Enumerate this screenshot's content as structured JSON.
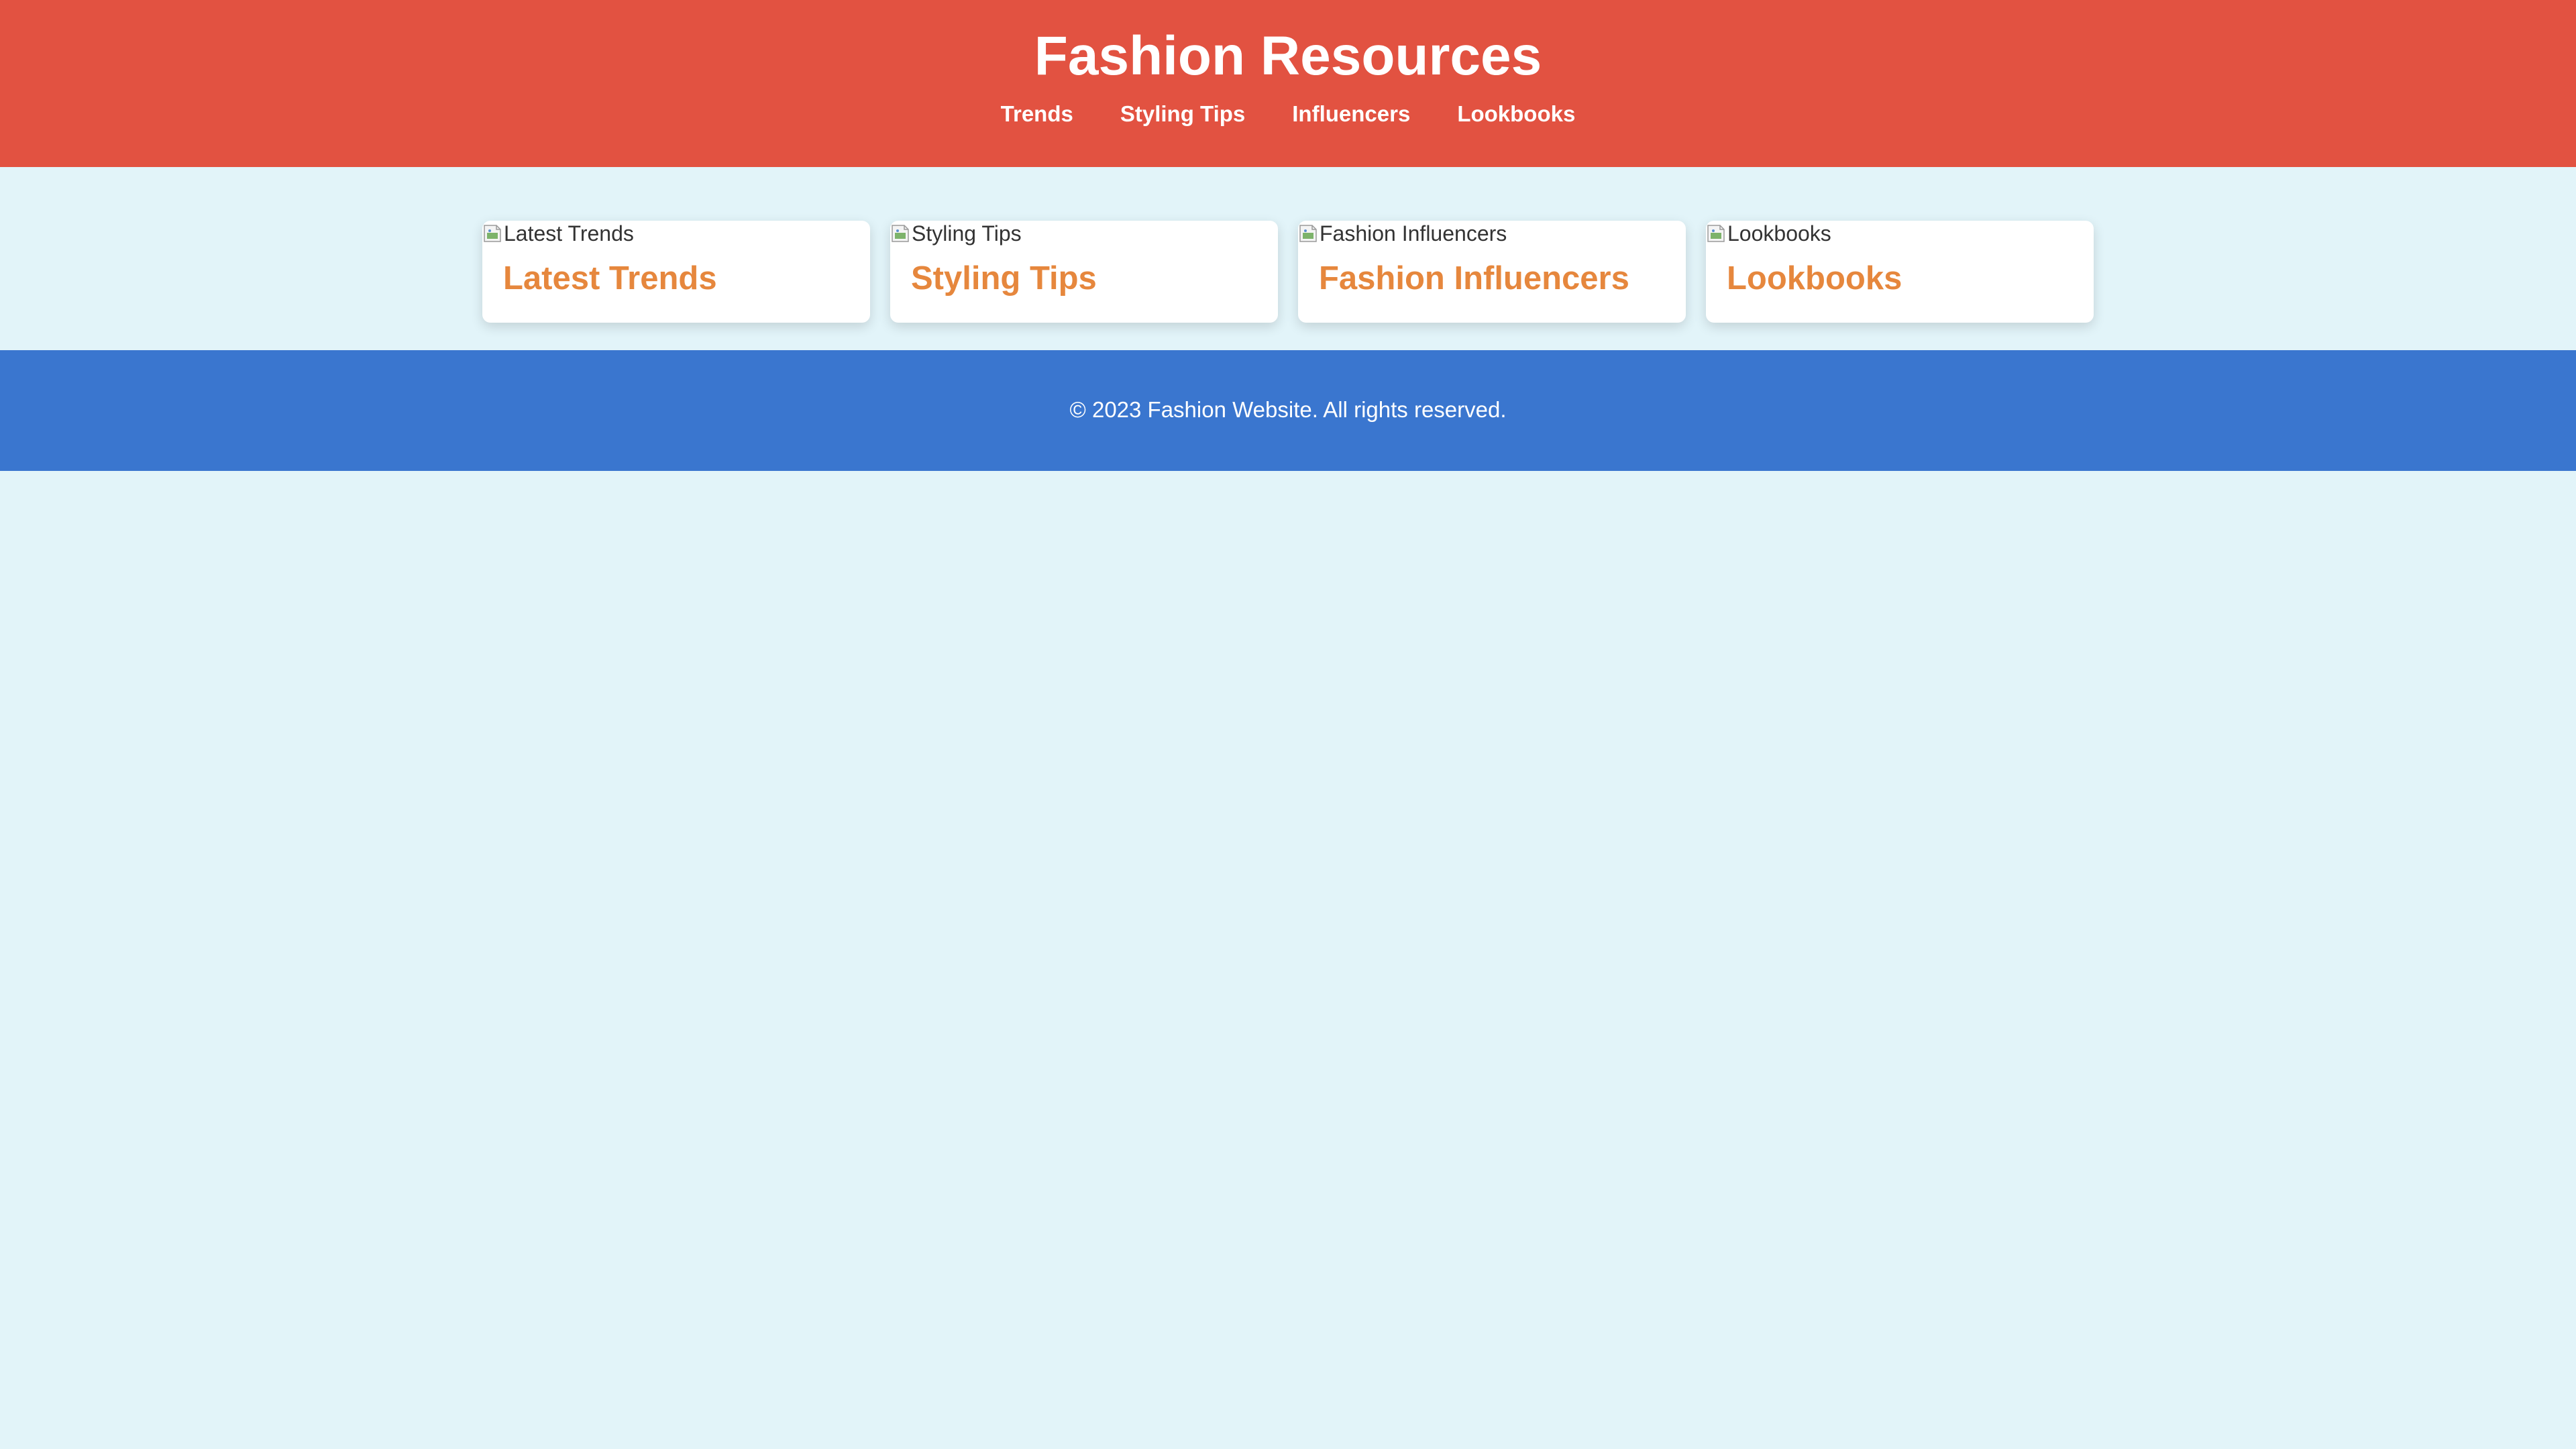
{
  "header": {
    "title": "Fashion Resources",
    "nav": [
      {
        "label": "Trends"
      },
      {
        "label": "Styling Tips"
      },
      {
        "label": "Influencers"
      },
      {
        "label": "Lookbooks"
      }
    ]
  },
  "cards": [
    {
      "image_alt": "Latest Trends",
      "title": "Latest Trends"
    },
    {
      "image_alt": "Styling Tips",
      "title": "Styling Tips"
    },
    {
      "image_alt": "Fashion Influencers",
      "title": "Fashion Influencers"
    },
    {
      "image_alt": "Lookbooks",
      "title": "Lookbooks"
    }
  ],
  "footer": {
    "copyright": "© 2023 Fashion Website. All rights reserved."
  },
  "colors": {
    "header_bg": "#e25241",
    "page_bg": "#e2f4f9",
    "card_title": "#e6873d",
    "footer_bg": "#3a76cf"
  },
  "icons": {
    "card_image": "broken-image-icon"
  }
}
